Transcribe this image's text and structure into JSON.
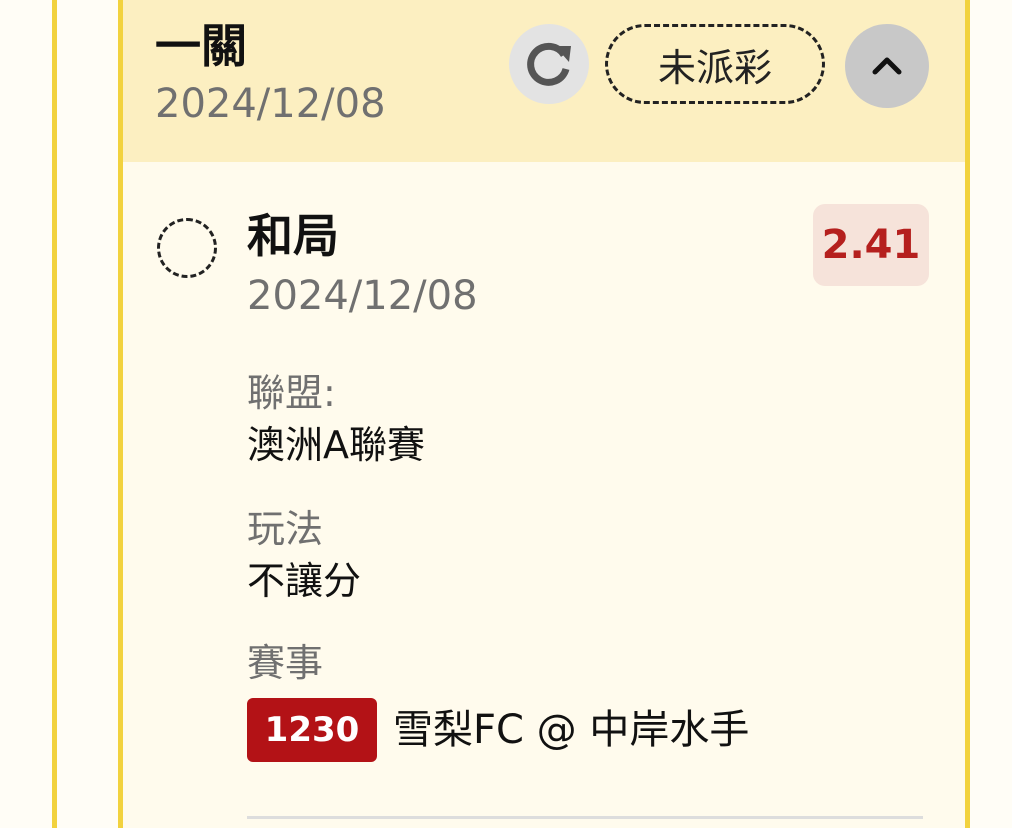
{
  "header": {
    "title": "一關",
    "date": "2024/12/08",
    "status_label": "未派彩"
  },
  "selection": {
    "name": "和局",
    "date": "2024/12/08",
    "odds": "2.41"
  },
  "details": {
    "league_label": "聯盟:",
    "league_value": "澳洲A聯賽",
    "bet_type_label": "玩法",
    "bet_type_value": "不讓分",
    "match_label": "賽事",
    "match_number": "1230",
    "match_name": "雪梨FC @ 中岸水手"
  },
  "icons": {
    "refresh": "refresh-icon",
    "collapse": "chevron-up-icon",
    "radio": "radio-unselected-icon"
  },
  "colors": {
    "card_border": "#f2d23e",
    "header_bg": "#fcefc1",
    "odds_text": "#b5201e",
    "odds_bg": "#f6e3da",
    "match_badge_bg": "#b31216"
  }
}
